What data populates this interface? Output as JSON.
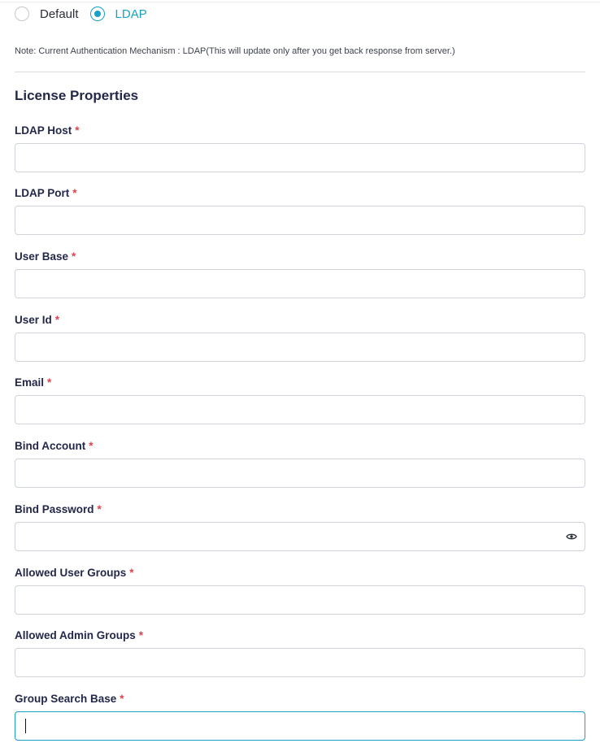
{
  "auth_mode": {
    "options": [
      {
        "label": "Default",
        "selected": false
      },
      {
        "label": "LDAP",
        "selected": true
      }
    ],
    "accent_color": "#1a9fc6"
  },
  "note": "Note: Current Authentication Mechanism : LDAP(This will update only after you get back response from server.)",
  "section_title": "License Properties",
  "required_marker": "*",
  "fields": [
    {
      "label": "LDAP Host",
      "value": ""
    },
    {
      "label": "LDAP Port",
      "value": ""
    },
    {
      "label": "User Base",
      "value": ""
    },
    {
      "label": "User Id",
      "value": ""
    },
    {
      "label": "Email",
      "value": ""
    },
    {
      "label": "Bind Account",
      "value": ""
    },
    {
      "label": "Bind Password",
      "value": "",
      "icon": "eye-icon"
    },
    {
      "label": "Allowed User Groups",
      "value": ""
    },
    {
      "label": "Allowed Admin Groups",
      "value": ""
    },
    {
      "label": "Group Search Base",
      "value": "",
      "focused": true
    }
  ]
}
